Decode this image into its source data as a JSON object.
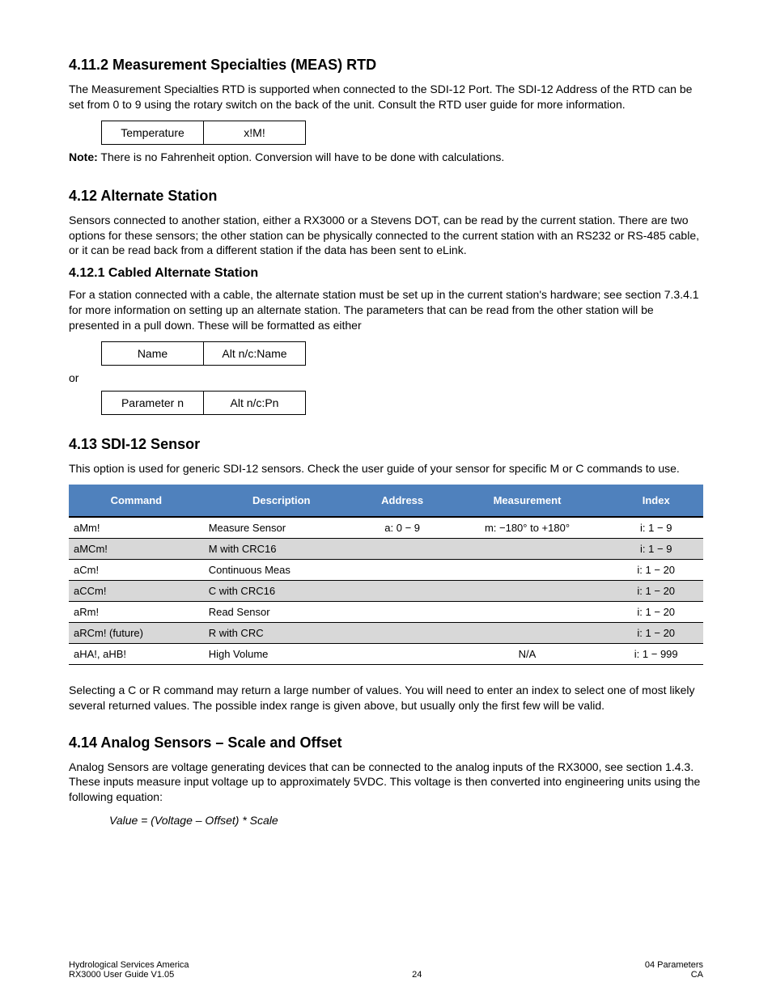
{
  "sections": {
    "measSpec": {
      "heading": "4.11.2 Measurement Specialties (MEAS) RTD",
      "para": "The Measurement Specialties RTD is supported when connected to the SDI-12 Port. The SDI-12 Address of the RTD can be set from 0 to 9 using the rotary switch on the back of the unit.  Consult the RTD user guide for more information.",
      "table": {
        "c1": "Temperature",
        "c2": "x!M!"
      },
      "note_label": "Note:",
      "note_text": " There is no Fahrenheit option.  Conversion will have to be done with calculations."
    },
    "altStation": {
      "heading": "4.12 Alternate Station",
      "intro": "Sensors connected to another station, either a RX3000 or a Stevens DOT, can be read by the current station.  There are two options for these sensors; the other station can be physically connected to the current station with an RS232 or RS-485 cable, or it can be read back from a different station if the data has been sent to eLink.",
      "cabled": {
        "heading": "4.12.1 Cabled Alternate Station",
        "para": "For a station connected with a cable, the alternate station must be set up in the current station's hardware; see section 7.3.4.1 for more information on setting up an alternate station.  The parameters that can be read from the other station will be presented in a pull down.  These will be formatted as either",
        "tableA": {
          "c1": "Name",
          "c2": "Alt n/c:Name"
        },
        "or": "or",
        "tableB": {
          "c1": "Parameter n",
          "c2": "Alt n/c:Pn"
        }
      }
    },
    "sdi12": {
      "heading": "4.13 SDI-12 Sensor",
      "para": "This option is used for generic SDI-12 sensors.  Check the user guide of your sensor for specific M or C commands to use.",
      "table": {
        "headers": [
          "Command",
          "Description",
          "Address",
          "Measurement",
          "Index"
        ],
        "rows": [
          [
            "aMm!",
            "Measure Sensor",
            "a: 0 − 9",
            "m: −180° to +180°",
            "i: 1 − 9"
          ],
          [
            "aMCm!",
            "M with CRC16",
            "",
            "",
            "i: 1 − 9"
          ],
          [
            "aCm!",
            "Continuous Meas",
            "",
            "",
            "i: 1 − 20"
          ],
          [
            "aCCm!",
            "C with CRC16",
            "",
            "",
            "i: 1 − 20"
          ],
          [
            "aRm!",
            "Read Sensor",
            "",
            "",
            "i: 1 − 20"
          ],
          [
            "aRCm! (future)",
            "R with CRC",
            "",
            "",
            "i: 1 − 20"
          ],
          [
            "aHA!, aHB!",
            "High Volume",
            "",
            "N/A",
            "i: 1 − 999"
          ]
        ]
      },
      "after": "Selecting a C or R command may return a large number of values.  You will need to enter an index to select one of most likely several returned values.  The possible index range is given above, but usually only the first few will be valid."
    },
    "analog": {
      "heading": "4.14 Analog Sensors – Scale and Offset",
      "para": "Analog Sensors are voltage generating devices that can be connected to the analog inputs of the RX3000, see section 1.4.3.  These inputs measure input voltage up to approximately 5VDC.  This voltage is then converted into engineering units using the following equation:",
      "equation": "Value = (Voltage – Offset) * Scale"
    }
  },
  "footer": {
    "left_line1": "Hydrological Services America",
    "left_line2": "RX3000 User Guide V1.05",
    "center": "24",
    "right_line1": "04 Parameters",
    "right_line2": "CA"
  }
}
